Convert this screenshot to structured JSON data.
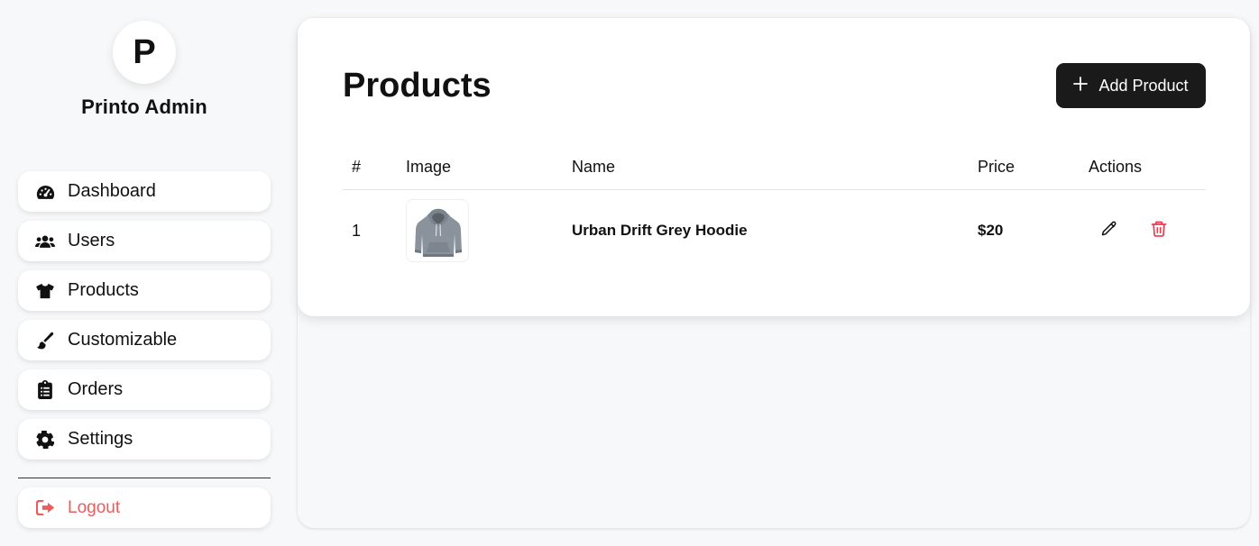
{
  "brand": {
    "initial": "P",
    "name": "Printo Admin"
  },
  "sidebar": {
    "items": [
      {
        "label": "Dashboard",
        "icon": "gauge-icon"
      },
      {
        "label": "Users",
        "icon": "users-icon"
      },
      {
        "label": "Products",
        "icon": "tshirt-icon"
      },
      {
        "label": "Customizable",
        "icon": "paintbrush-icon"
      },
      {
        "label": "Orders",
        "icon": "clipboard-list-icon"
      },
      {
        "label": "Settings",
        "icon": "gear-icon"
      }
    ],
    "logout": {
      "label": "Logout",
      "icon": "sign-out-icon",
      "color": "#f05a5a"
    }
  },
  "main": {
    "title": "Products",
    "add_button": {
      "label": "Add Product",
      "icon": "plus-icon"
    },
    "table": {
      "headers": [
        "#",
        "Image",
        "Name",
        "Price",
        "Actions"
      ],
      "rows": [
        {
          "index": "1",
          "image": "grey-hoodie-thumbnail",
          "name": "Urban Drift Grey Hoodie",
          "price": "$20",
          "actions": [
            "edit-pencil-icon",
            "delete-trash-icon"
          ]
        }
      ]
    }
  },
  "colors": {
    "accent": "#1a1a1a",
    "danger": "#f0384f",
    "logout": "#f05a5a"
  }
}
